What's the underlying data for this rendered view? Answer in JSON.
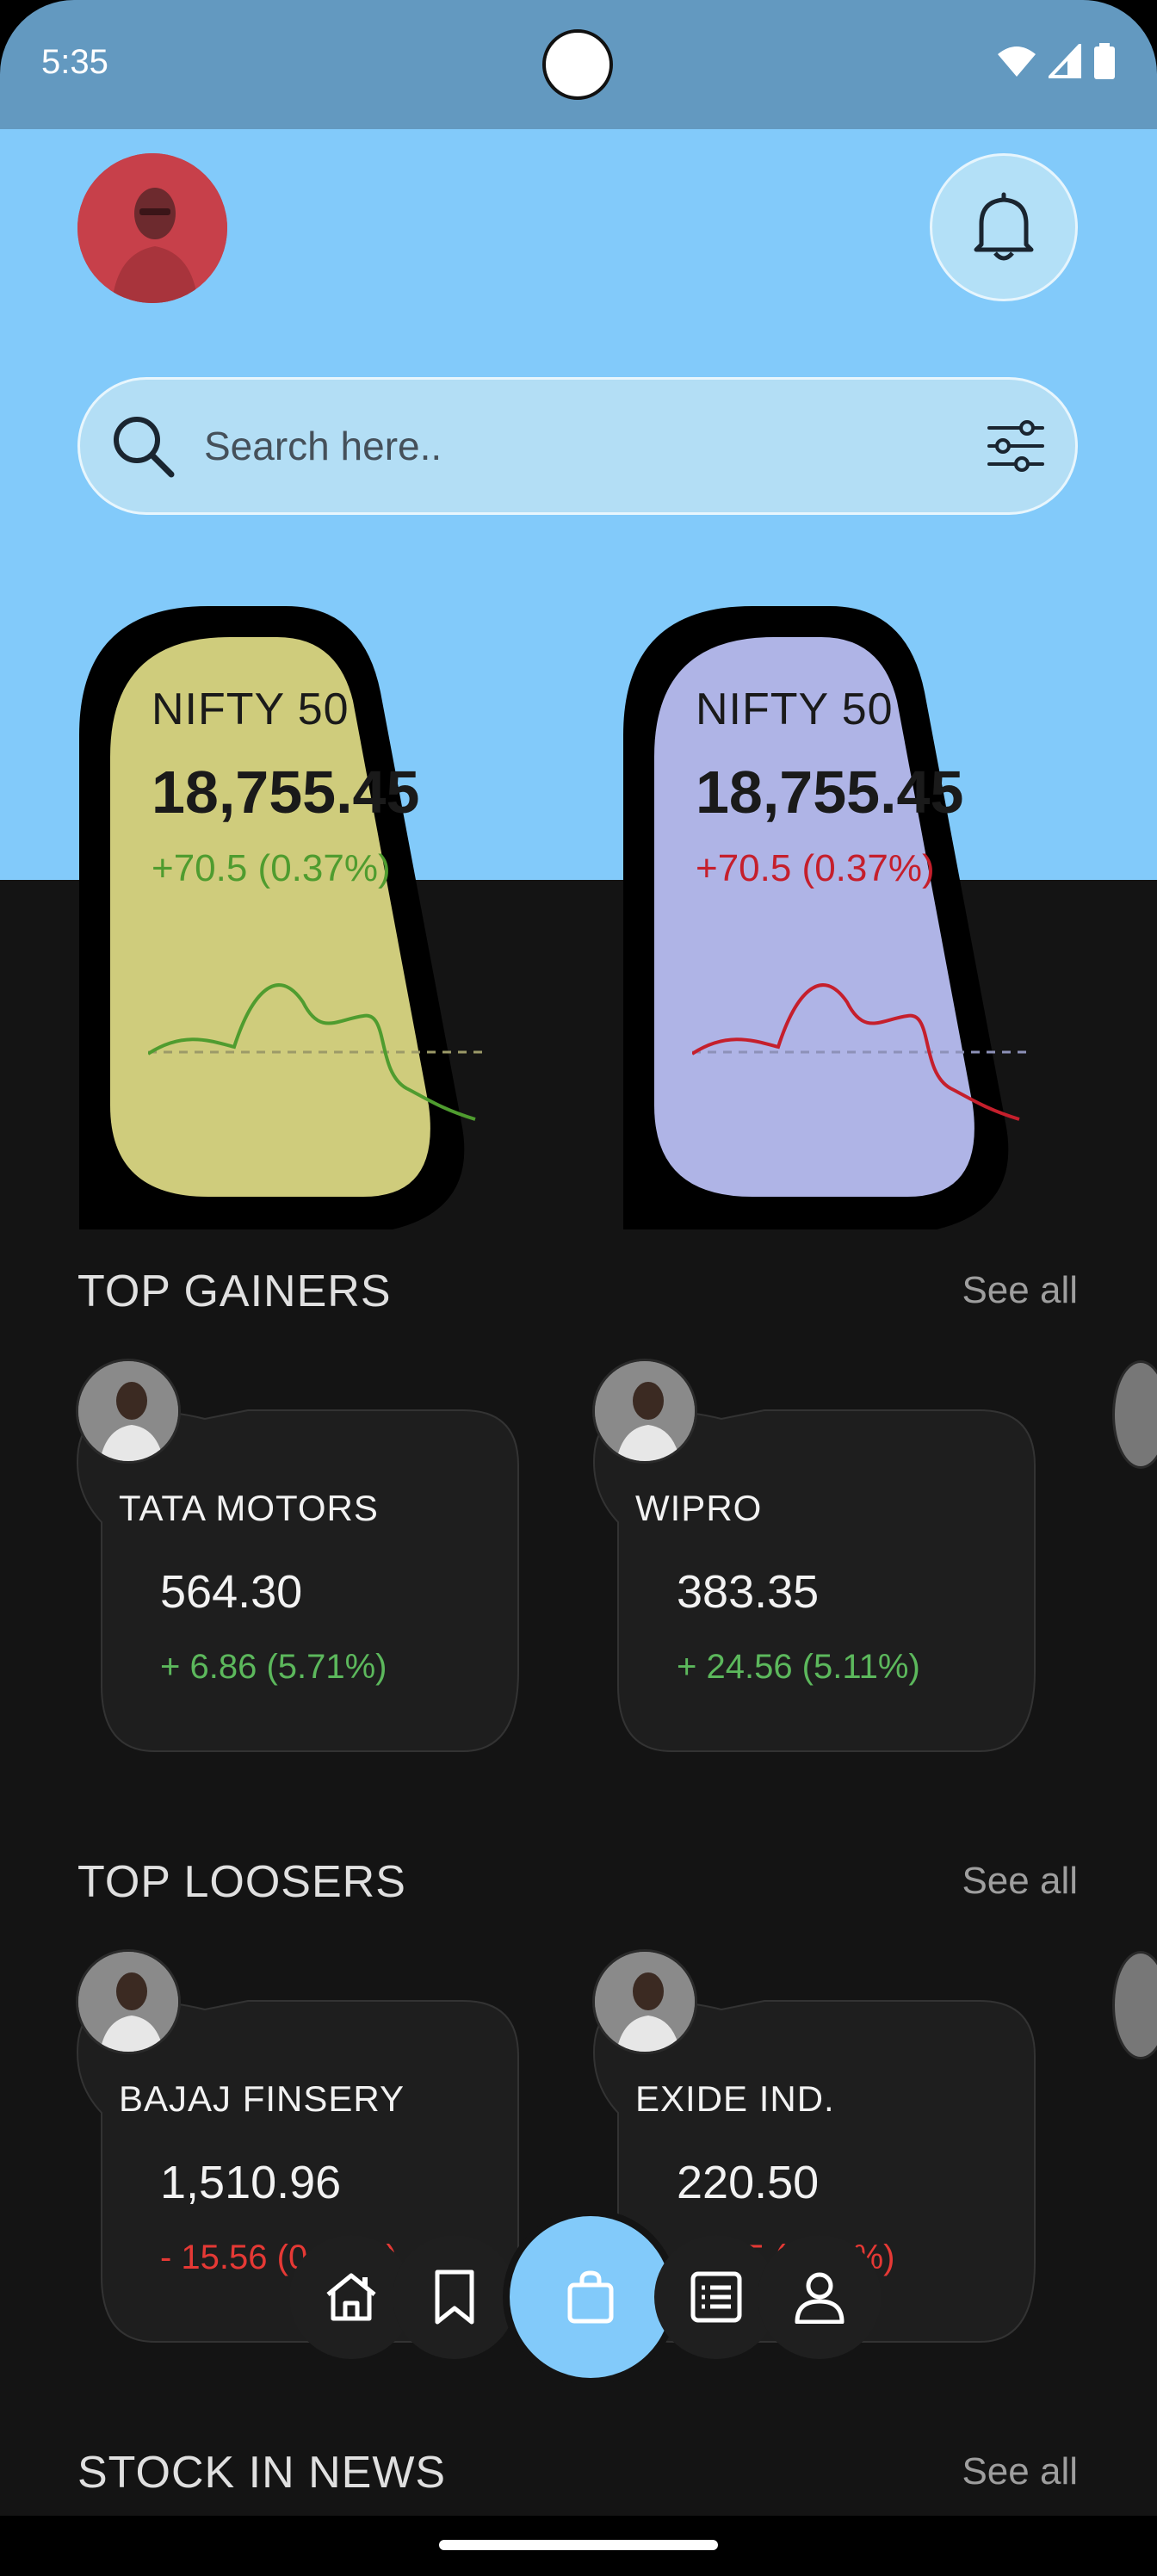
{
  "status_bar": {
    "time": "5:35"
  },
  "search": {
    "placeholder": "Search here.."
  },
  "indices": [
    {
      "name": "NIFTY 50",
      "value": "18,755.45",
      "change": "+70.5 (0.37%)",
      "color": "#cfcc7c",
      "trend_color": "#4f9c2f"
    },
    {
      "name": "NIFTY 50",
      "value": "18,755.45",
      "change": "+70.5 (0.37%)",
      "color": "#afb4e6",
      "trend_color": "#c51f2c"
    }
  ],
  "top_gainers": {
    "title": "TOP GAINERS",
    "see_all": "See all",
    "items": [
      {
        "name": "TATA MOTORS",
        "price": "564.30",
        "change": "+ 6.86 (5.71%)"
      },
      {
        "name": "WIPRO",
        "price": "383.35",
        "change": "+ 24.56 (5.11%)"
      }
    ]
  },
  "top_losers": {
    "title": "TOP LOOSERS",
    "see_all": "See all",
    "items": [
      {
        "name": "BAJAJ FINSERY",
        "price": "1,510.96",
        "change": "- 15.56 (0.36%)"
      },
      {
        "name": "EXIDE IND.",
        "price": "220.50",
        "change": "- 1.35 (0.61%)"
      }
    ]
  },
  "stock_in_news": {
    "title": "STOCK IN NEWS",
    "see_all": "See all"
  },
  "colors": {
    "accent": "#82cafa",
    "gain": "#5cb85c",
    "loss": "#e53935",
    "background": "#141414"
  },
  "nav": {
    "items": [
      "home-icon",
      "bookmark-icon",
      "bag-icon",
      "list-icon",
      "profile-icon"
    ],
    "active": "bag-icon"
  }
}
